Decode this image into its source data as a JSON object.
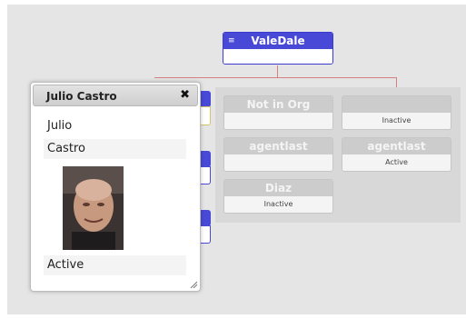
{
  "org": {
    "root": {
      "menu_icon": "≡",
      "name": "ValeDale"
    },
    "nodes": [
      {
        "name": "Not in Org",
        "status": ""
      },
      {
        "name": "",
        "status": "Inactive"
      },
      {
        "name": "agentlast",
        "status": ""
      },
      {
        "name": "agentlast",
        "status": "Active"
      },
      {
        "name": "Diaz",
        "status": "Inactive"
      }
    ]
  },
  "popup": {
    "title": "Julio Castro",
    "close_icon": "✖",
    "first_name": "Julio",
    "last_name": "Castro",
    "status": "Active",
    "photo_alt": "Julio Castro photo"
  },
  "colors": {
    "node_header_blue": "#4949d8",
    "connector": "#d48080",
    "canvas": "#e5e5e5"
  }
}
